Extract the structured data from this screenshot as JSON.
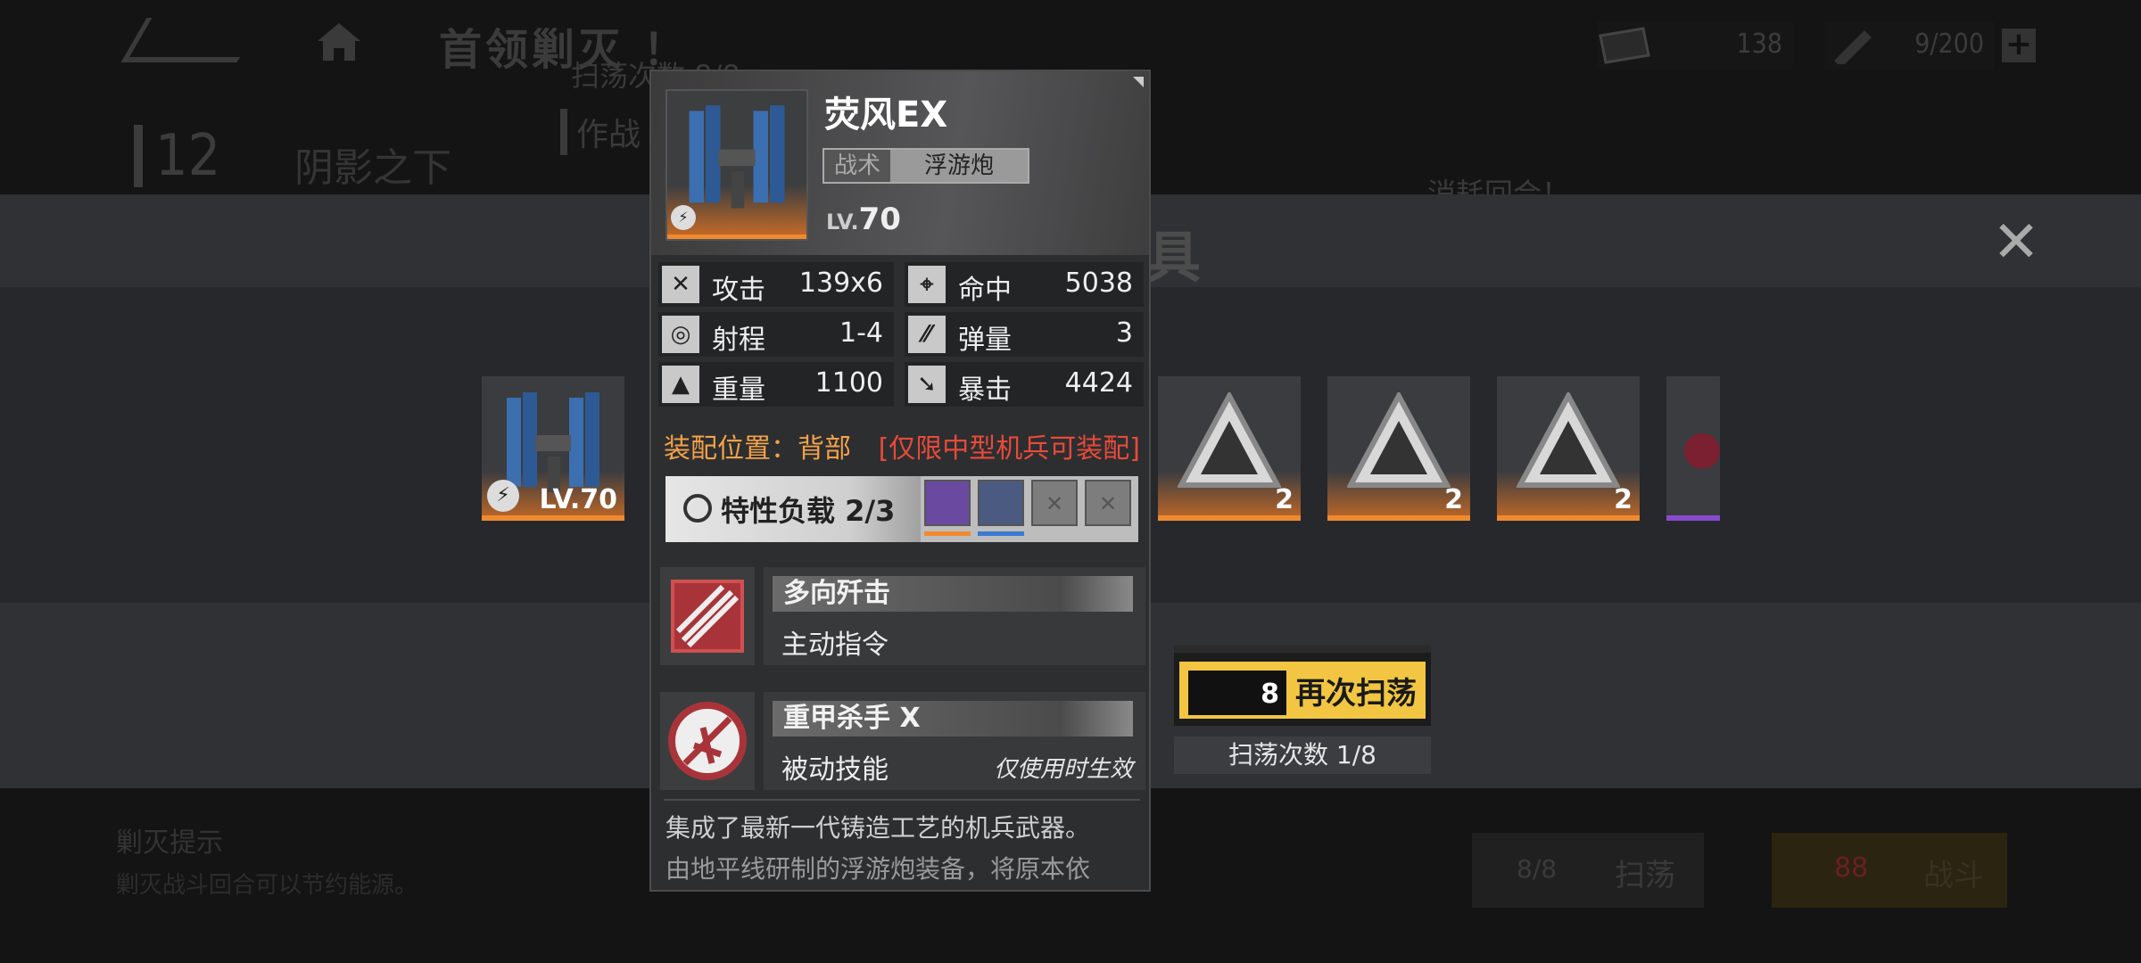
{
  "background": {
    "title": "首领剿灭 ！",
    "stage_no": "12",
    "stage_name": "阴影之下",
    "sweep_count": "扫荡次数 8/8",
    "op_label": "作战",
    "consume_label": "消耗回合！",
    "tip_title": "剿灭提示",
    "tip_text": "剿灭战斗回合可以节约能源。",
    "sweep_label": "扫荡",
    "sweep_count_small": "8/8",
    "fight_label": "战斗",
    "fight_cost": "88"
  },
  "resources": {
    "currency_value": "138",
    "energy_value": "9/200"
  },
  "dialog": {
    "title": "获得道具",
    "items": [
      {
        "name": "荧风EX",
        "level": "LV.70",
        "type": "weapon"
      },
      {
        "count": "2",
        "type": "triangle-core"
      },
      {
        "count": "2",
        "type": "triangle-core"
      },
      {
        "count": "2",
        "type": "triangle-core"
      }
    ],
    "sweep_again_label": "再次扫荡",
    "sweep_again_cost": "8",
    "sweep_count_label": "扫荡次数 1/8"
  },
  "card": {
    "name": "荧风EX",
    "tag_category": "战术",
    "tag_type": "浮游炮",
    "level_prefix": "LV.",
    "level": "70",
    "stats": [
      {
        "icon": "attack-icon",
        "key": "攻击",
        "value": "139x6"
      },
      {
        "icon": "accuracy-icon",
        "key": "命中",
        "value": "5038"
      },
      {
        "icon": "range-icon",
        "key": "射程",
        "value": "1-4"
      },
      {
        "icon": "ammo-icon",
        "key": "弹量",
        "value": "3"
      },
      {
        "icon": "weight-icon",
        "key": "重量",
        "value": "1100"
      },
      {
        "icon": "crit-icon",
        "key": "暴击",
        "value": "4424"
      }
    ],
    "slot": "装配位置：背部",
    "slot_warn": "[仅限中型机兵可装配]",
    "trait_label": "特性负载 2/3",
    "skills": [
      {
        "name": "多向歼击",
        "type": "主动指令",
        "note": ""
      },
      {
        "name": "重甲杀手 X",
        "type": "被动技能",
        "note": "仅使用时生效"
      }
    ],
    "description_line1": "集成了最新一代铸造工艺的机兵武器。",
    "description_line2": "由地平线研制的浮游炮装备，将原本依"
  },
  "colors": {
    "accent_orange": "#f08a30",
    "warn_red": "#e84a3a",
    "slot_orange": "#f2a24a",
    "sweep_yellow": "#f2c642"
  }
}
